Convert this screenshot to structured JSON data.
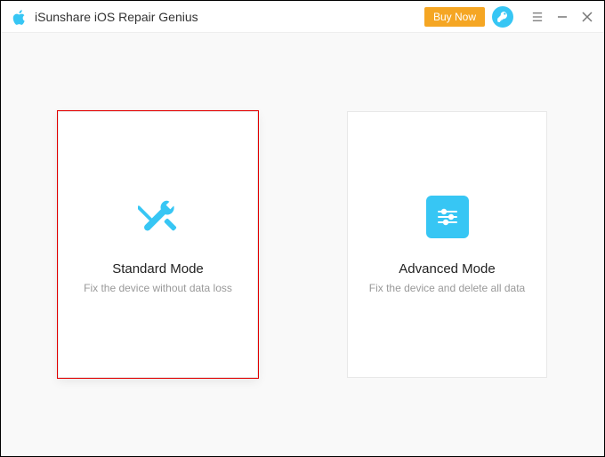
{
  "titlebar": {
    "app_name": "iSunshare iOS Repair Genius",
    "buy_now": "Buy Now"
  },
  "modes": {
    "standard": {
      "title": "Standard Mode",
      "subtitle": "Fix the device without data loss"
    },
    "advanced": {
      "title": "Advanced Mode",
      "subtitle": "Fix the device and delete all data"
    }
  },
  "colors": {
    "accent": "#37c6f4",
    "buy": "#f5a623",
    "selected": "#e30000"
  }
}
